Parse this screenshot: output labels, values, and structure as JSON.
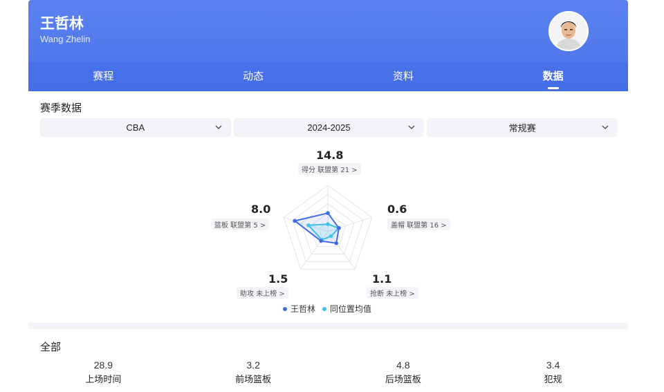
{
  "player": {
    "name_cn": "王哲林",
    "name_en": "Wang Zhelin"
  },
  "tabs": [
    {
      "label": "赛程"
    },
    {
      "label": "动态"
    },
    {
      "label": "资料"
    },
    {
      "label": "数据"
    }
  ],
  "season": {
    "title": "赛季数据",
    "filters": [
      {
        "value": "CBA"
      },
      {
        "value": "2024-2025"
      },
      {
        "value": "常规赛"
      }
    ]
  },
  "radar": {
    "stats": [
      {
        "key": "points",
        "value": "14.8",
        "rank": "得分 联盟第 21 >",
        "player": 0.4,
        "avg": 0.16
      },
      {
        "key": "blocks",
        "value": "0.6",
        "rank": "盖帽 联盟第 16 >",
        "player": 0.25,
        "avg": 0.25
      },
      {
        "key": "steals",
        "value": "1.1",
        "rank": "抢断 未上榜 >",
        "player": 0.31,
        "avg": 0.12
      },
      {
        "key": "assists",
        "value": "1.5",
        "rank": "助攻 未上榜 >",
        "player": 0.25,
        "avg": 0.22
      },
      {
        "key": "rebounds",
        "value": "8.0",
        "rank": "篮板 联盟第 5 >",
        "player": 0.75,
        "avg": 0.44
      }
    ],
    "legend": {
      "player": "王哲林",
      "average": "同位置均值"
    },
    "colors": {
      "player": "#3f6be6",
      "average": "#3dc6e8",
      "grid": "#e3e5ea"
    }
  },
  "totals": {
    "title": "全部",
    "items": [
      {
        "value": "28.9",
        "label": "上场时间"
      },
      {
        "value": "3.2",
        "label": "前场篮板"
      },
      {
        "value": "4.8",
        "label": "后场篮板"
      },
      {
        "value": "3.4",
        "label": "犯规"
      }
    ]
  }
}
